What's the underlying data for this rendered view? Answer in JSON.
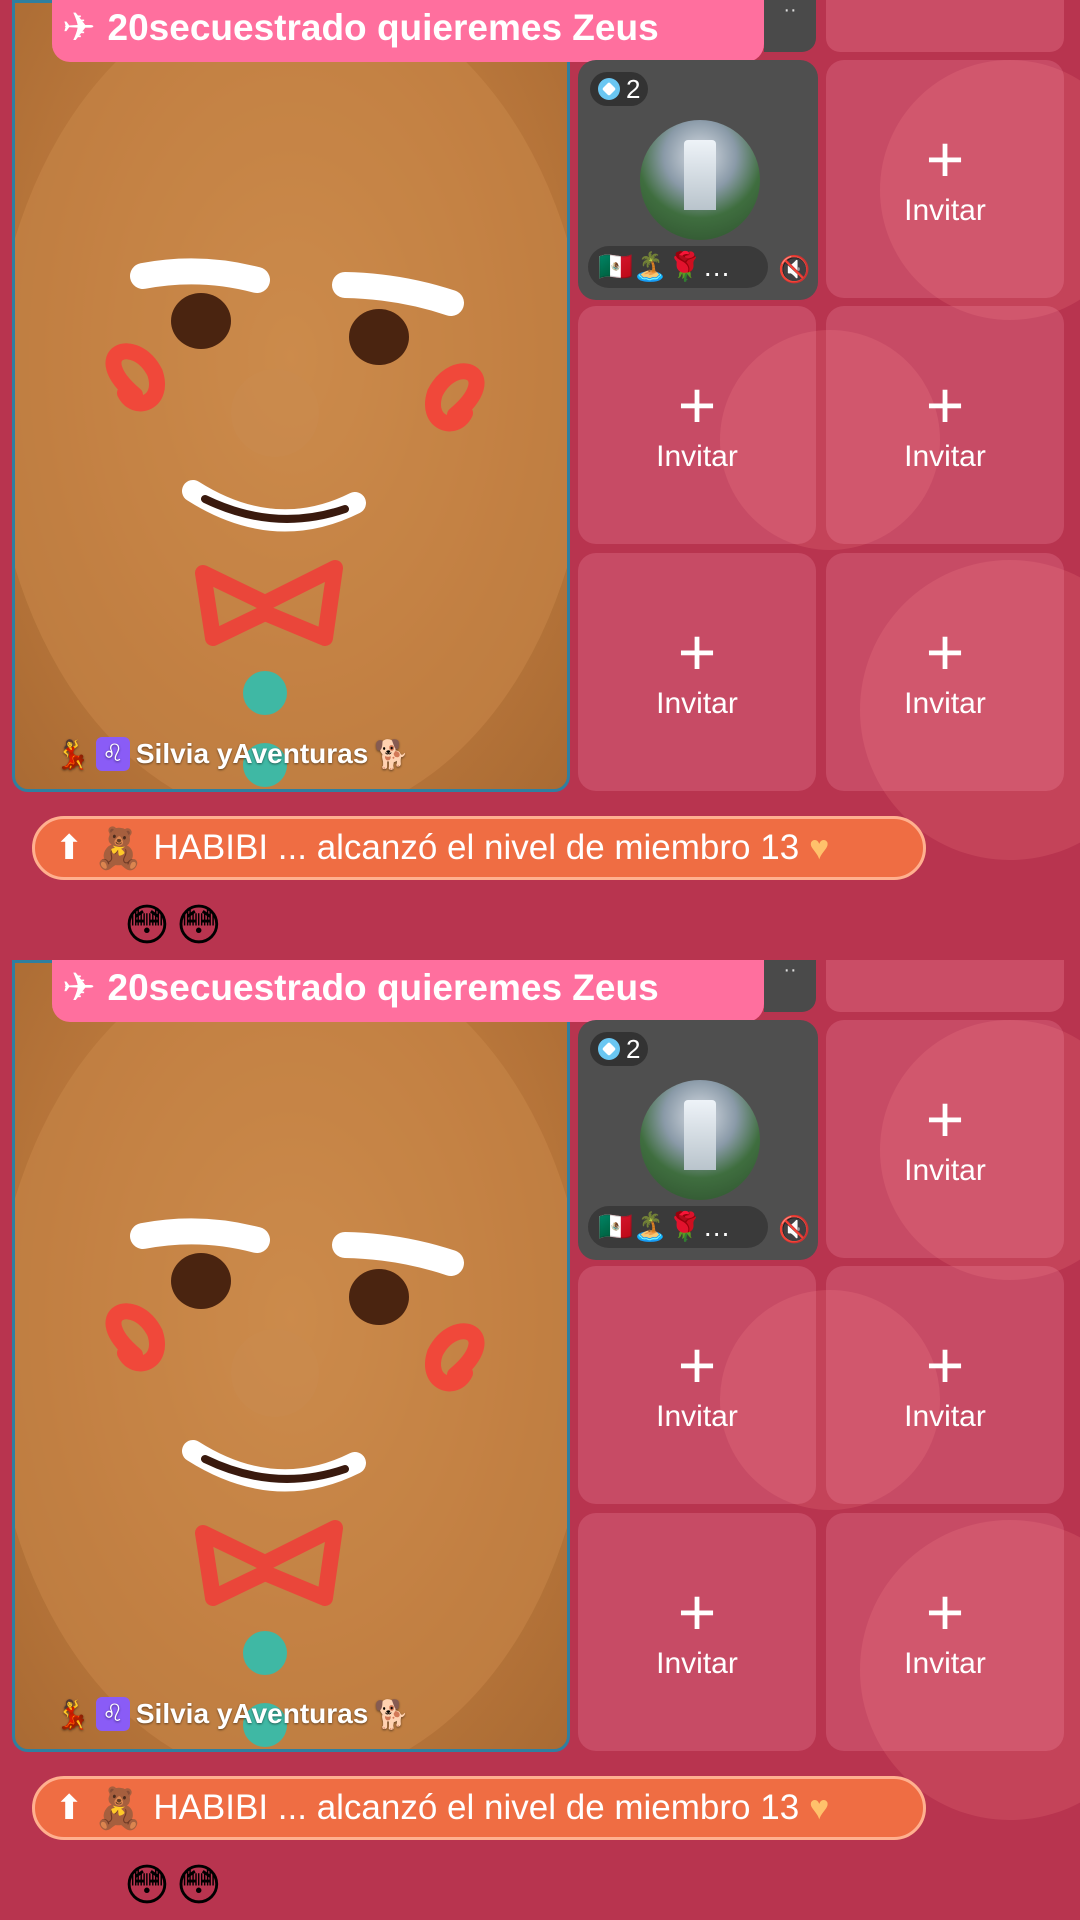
{
  "room": {
    "title": "20secuestrado  quieremes Zeus",
    "title_icon": "airplane-icon"
  },
  "host": {
    "name": "Silvia yAventuras",
    "name_prefix_icons": [
      "dancer-emoji",
      "leo-sign-icon"
    ],
    "name_suffix_icon": "dog-emoji",
    "leo_symbol": "♌"
  },
  "guest": {
    "level": "2",
    "name": "🇲🇽🏝️🌹…"
  },
  "invite": {
    "label": "Invitar",
    "plus": "+"
  },
  "notification": {
    "text": "HABIBI ... alcanzó el nivel de miembro 13",
    "icons": [
      "arrow-up-icon",
      "teddy-bear-emoji",
      "heart-emoji"
    ]
  },
  "reaction": {
    "text": "😳😳"
  },
  "colors": {
    "background": "#b8344f",
    "title_pill": "#ff6f9e",
    "notification": "#ef6d43",
    "host_border": "#2f7fa0"
  }
}
